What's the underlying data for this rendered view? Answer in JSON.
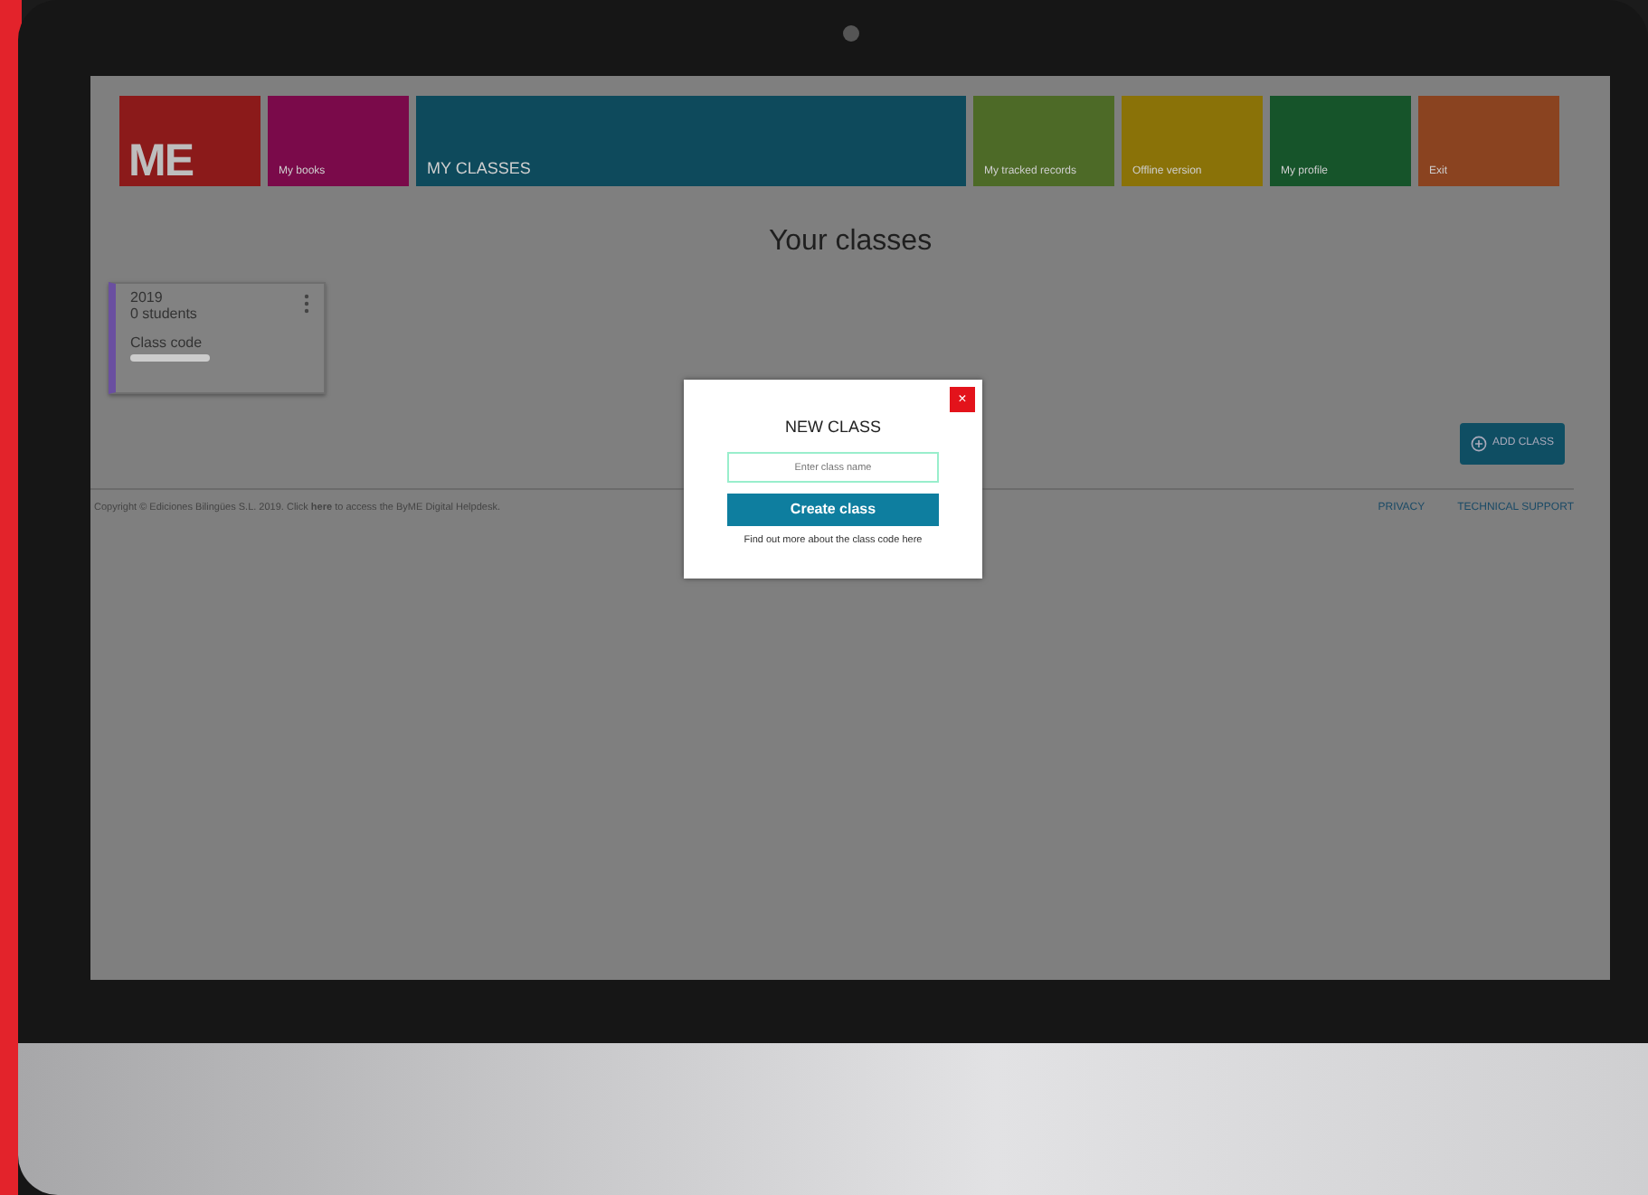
{
  "header": {
    "logo": "ME",
    "tiles": [
      {
        "label": "My books",
        "color": "#7a0a4a",
        "selected": false
      },
      {
        "label": "MY CLASSES",
        "color": "#0e4a5c",
        "selected": true
      },
      {
        "label": "My tracked records",
        "color": "#4d6a27",
        "selected": false
      },
      {
        "label": "Offline version",
        "color": "#8a7208",
        "selected": false
      },
      {
        "label": "My profile",
        "color": "#16542a",
        "selected": false
      },
      {
        "label": "Exit",
        "color": "#8a4320",
        "selected": false
      }
    ]
  },
  "title": "Your classes",
  "classes": [
    {
      "year": "2019",
      "students": "0 students",
      "code_label": "Class code",
      "color": "#6a4fa0"
    }
  ],
  "add_button": "ADD CLASS",
  "footer": {
    "copyright": "Copyright © Ediciones Bilingües S.L. 2019. Click **here** to access the ByME Digital Helpdesk.",
    "links": [
      "PRIVACY",
      "TECHNICAL SUPPORT"
    ]
  },
  "modal": {
    "close": "×",
    "title": "NEW CLASS",
    "placeholder": "Enter class name",
    "button": "Create class",
    "note": "Find out more about the class code",
    "link": "here"
  }
}
